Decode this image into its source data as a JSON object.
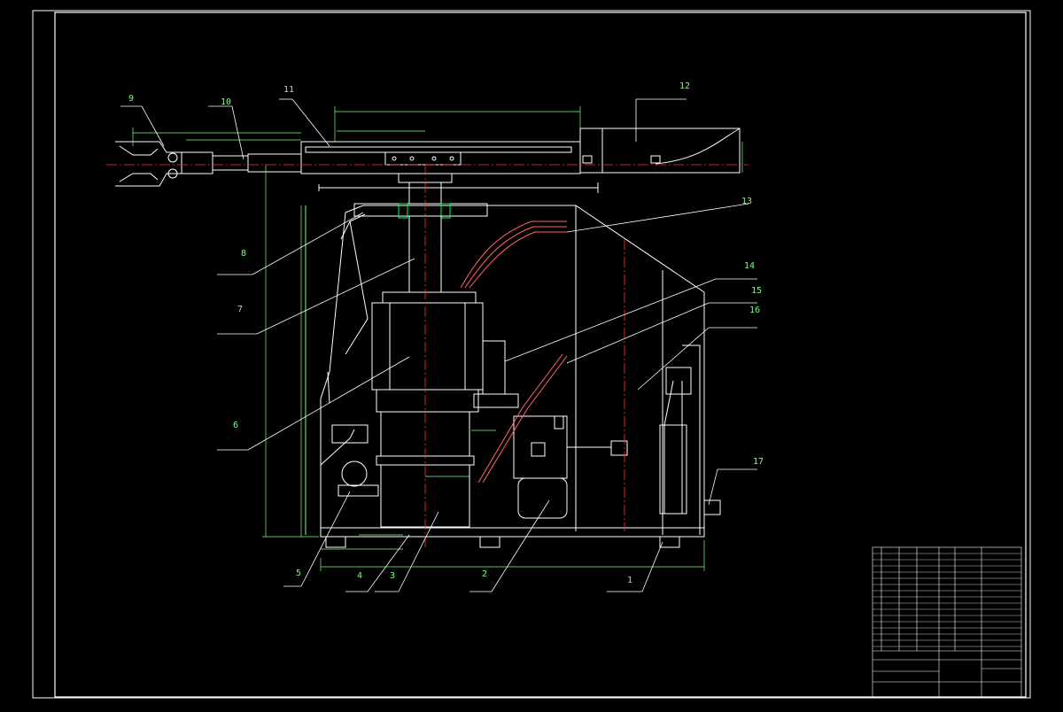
{
  "drawing": {
    "callouts": [
      "9",
      "10",
      "11",
      "12",
      "13",
      "14",
      "15",
      "16",
      "17",
      "8",
      "7",
      "6",
      "5",
      "4",
      "3",
      "2",
      "1"
    ],
    "colors": {
      "background": "#000000",
      "frame": "#ffffff",
      "outline": "#ffffff",
      "dimension": "#7fff7f",
      "centerline": "#ff3333",
      "hose": "#ff6666",
      "accent": "#00ff66",
      "title_text": "#00ffff"
    }
  }
}
